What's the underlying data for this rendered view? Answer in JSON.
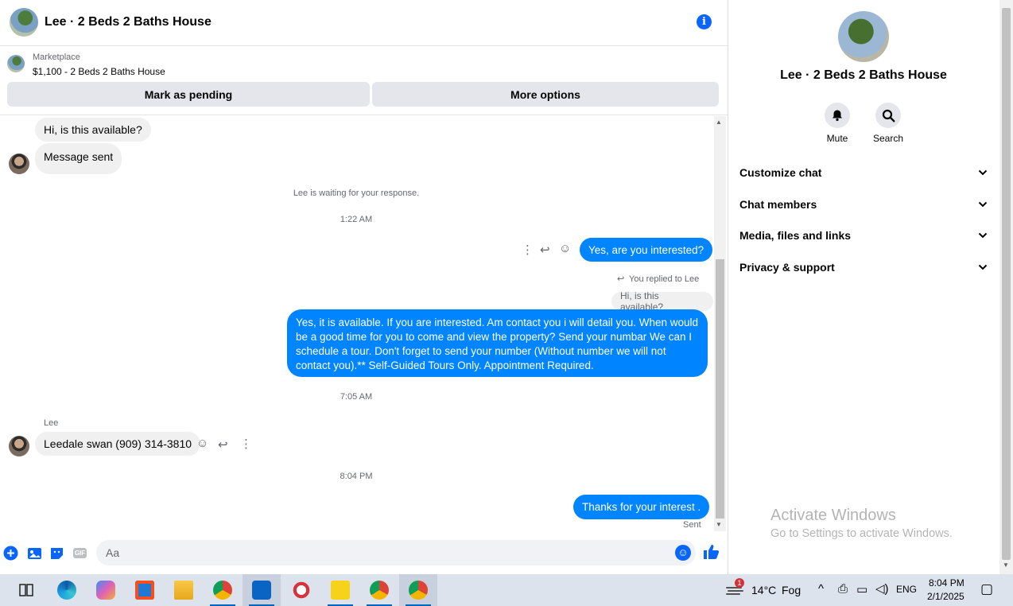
{
  "chat": {
    "title": "Lee · 2 Beds 2 Baths House",
    "listing": {
      "kicker": "Marketplace",
      "line": "$1,100 - 2 Beds 2 Baths House",
      "pending_label": "Mark as pending",
      "more_label": "More options"
    },
    "messages": {
      "m1": "Hi, is this available?",
      "m2": "Message sent",
      "waiting": "Lee is waiting for your response.",
      "t1": "1:22 AM",
      "m3": "Yes, are you interested?",
      "replied": "You replied to Lee",
      "quoted": "Hi, is this available?",
      "m4": "Yes, it is available. If you are interested.  Am contact you i will detail you.  When would be a good time for you to come and view the property? Send your numbar We can I schedule a tour.  Don't forget to send your number (Without number we will not contact you).** Self-Guided Tours Only. Appointment Required.",
      "t2": "7:05 AM",
      "sender": "Lee",
      "m5": "Leedale swan (909) 314-3810",
      "t3": "8:04 PM",
      "m6": "Thanks for your interest .",
      "status": "Sent"
    },
    "composer": {
      "placeholder": "Aa",
      "gif": "GIF"
    }
  },
  "panel": {
    "title": "Lee · 2 Beds 2 Baths House",
    "mute_label": "Mute",
    "search_label": "Search",
    "sections": [
      "Customize chat",
      "Chat members",
      "Media, files and links",
      "Privacy & support"
    ]
  },
  "watermark": {
    "title": "Activate Windows",
    "subtitle": "Go to Settings to activate Windows."
  },
  "taskbar": {
    "weather_temp": "14°C",
    "weather_desc": "Fog",
    "weather_badge": "1",
    "language": "ENG",
    "time": "8:04 PM",
    "date": "2/1/2025"
  },
  "colors": {
    "accent": "#0866ff",
    "outgoing_bubble": "#0084ff",
    "incoming_bubble": "#f0f0f0"
  }
}
